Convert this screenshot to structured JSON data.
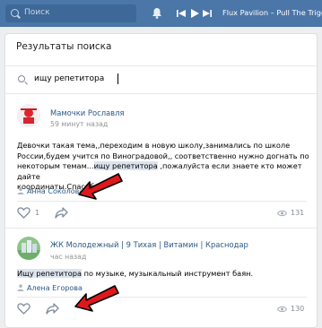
{
  "topbar": {
    "search_placeholder": "Поиск",
    "track": "Flux Pavilion – Pull The Trigger"
  },
  "page": {
    "title": "Результаты поиска",
    "query": "ищу репетитора"
  },
  "posts": [
    {
      "author": "Мамочки Рославля",
      "time": "59 минут назад",
      "text_lines": [
        "Девочки такая тема,,переходим в новую школу,занимались по школе",
        "России,будем учится по Виноградовой,, соответственно нужно догнать по"
      ],
      "text_pre": "некоторым темам...",
      "text_match": "ищу репетитора",
      "text_post": " ,пожалуйста если знаете кто может дайте",
      "text_last": "координаты.Спасибо!!",
      "signer": "Анна Соколова",
      "likes": "1",
      "views": "131"
    },
    {
      "author": "ЖК Молодежный | 9 Тихая | Витамин | Краснодар",
      "time": "час назад",
      "text_match": "Ищу репетитора",
      "text_post": " по музыке, музыкальный инструмент баян.",
      "signer": "Алена Егорова",
      "views": "130"
    }
  ],
  "colors": {
    "topbar": "#4a76a8",
    "link": "#2a5885",
    "arrow": "#e0181b"
  }
}
